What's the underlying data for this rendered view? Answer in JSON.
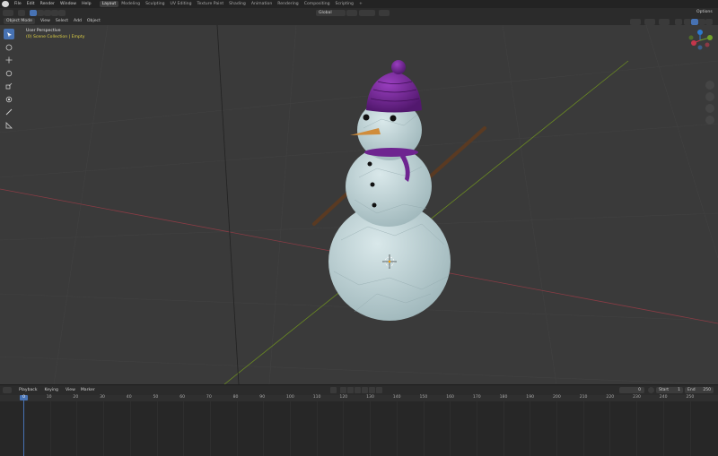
{
  "app": {
    "top_menu": [
      "File",
      "Edit",
      "Render",
      "Window",
      "Help"
    ],
    "workspace_tabs": [
      "Layout",
      "Modeling",
      "Sculpting",
      "UV Editing",
      "Texture Paint",
      "Shading",
      "Animation",
      "Rendering",
      "Compositing",
      "Scripting"
    ],
    "active_tab": "Layout",
    "add_tab": "+"
  },
  "header": {
    "transform_orientation": "Global",
    "options": "Options"
  },
  "viewport_header": {
    "mode": "Object Mode",
    "menus": [
      "View",
      "Select",
      "Add",
      "Object"
    ]
  },
  "viewport": {
    "view_name": "User Perspective",
    "collection_info": "(0) Scene Collection | Empty",
    "colors": {
      "background": "#3a3a3a",
      "x_axis": "#8a3c45",
      "y_axis": "#6b8c22",
      "snow": "#c7d9dc",
      "hat": "#6e2490",
      "carrot": "#d08c3a",
      "arms": "#5a3a22",
      "eyes": "#111111"
    }
  },
  "gizmo": {
    "labels": [
      "Z",
      "Y",
      "X"
    ]
  },
  "timeline": {
    "menus": [
      "Playback",
      "Keying",
      "View",
      "Marker"
    ],
    "current_frame": "0",
    "start_label": "Start",
    "start_value": "1",
    "end_label": "End",
    "end_value": "250",
    "playhead_frame": "0",
    "ticks": [
      "10",
      "20",
      "30",
      "40",
      "50",
      "60",
      "70",
      "80",
      "90",
      "100",
      "110",
      "120",
      "130",
      "140",
      "150",
      "160",
      "170",
      "180",
      "190",
      "200",
      "210",
      "220",
      "230",
      "240",
      "250"
    ]
  }
}
